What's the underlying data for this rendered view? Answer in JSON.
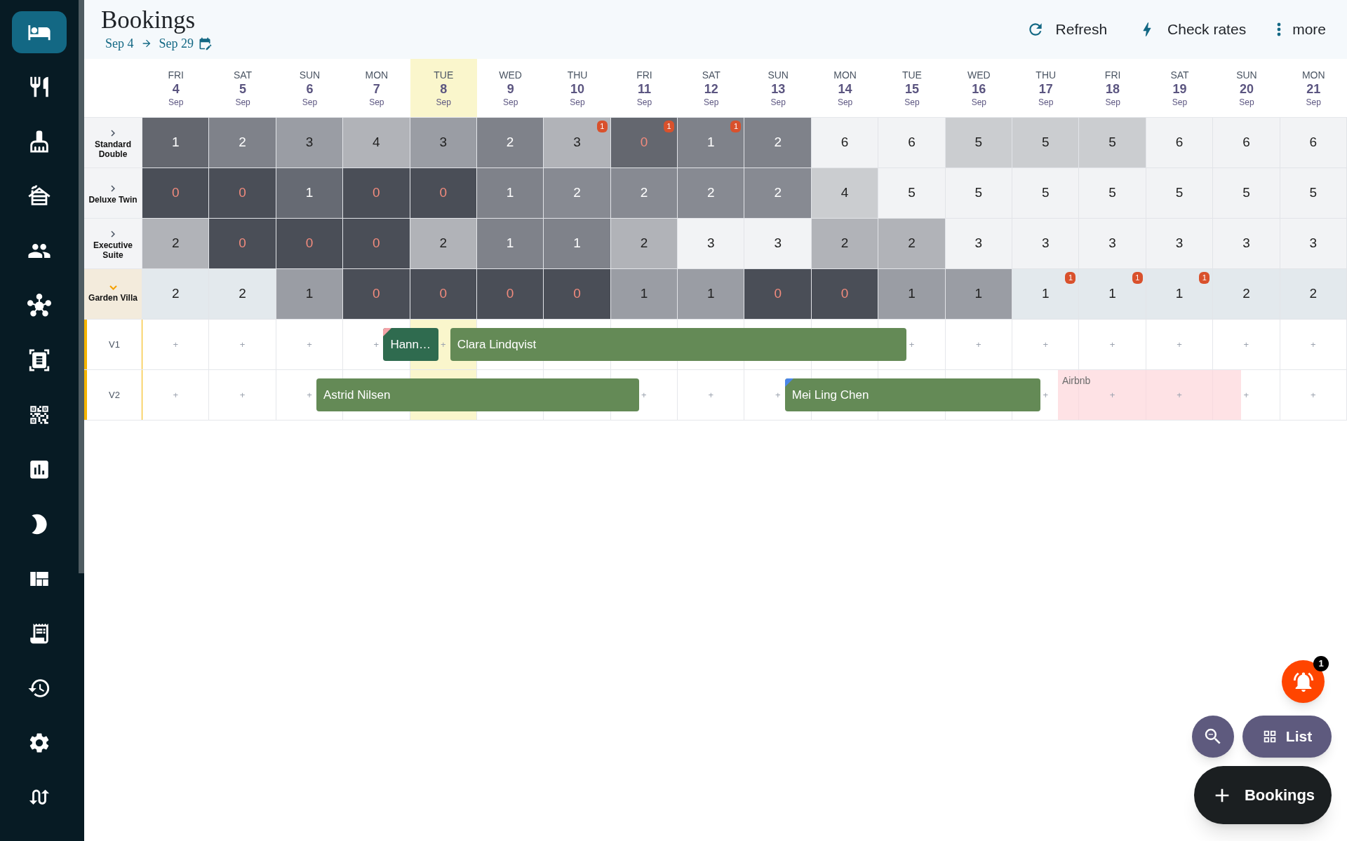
{
  "sidebar": {
    "items": [
      {
        "selected": true
      },
      {
        "selected": false
      },
      {
        "selected": false
      },
      {
        "selected": false
      },
      {
        "selected": false
      },
      {
        "selected": false
      },
      {
        "selected": false
      },
      {
        "selected": false
      },
      {
        "selected": false
      },
      {
        "selected": false
      },
      {
        "selected": false
      },
      {
        "selected": false
      },
      {
        "selected": false
      },
      {
        "selected": false
      },
      {
        "selected": false
      }
    ]
  },
  "header": {
    "title": "Bookings",
    "date_from": "Sep 4",
    "date_to": "Sep 29",
    "actions": [
      {
        "kind": "refresh",
        "label": "Refresh"
      },
      {
        "kind": "rates",
        "label": "Check rates"
      },
      {
        "kind": "more",
        "label": "more"
      }
    ]
  },
  "days": [
    {
      "weekday": "FRI",
      "day": "4",
      "month": "Sep",
      "today": false
    },
    {
      "weekday": "SAT",
      "day": "5",
      "month": "Sep",
      "today": false
    },
    {
      "weekday": "SUN",
      "day": "6",
      "month": "Sep",
      "today": false
    },
    {
      "weekday": "MON",
      "day": "7",
      "month": "Sep",
      "today": false
    },
    {
      "weekday": "TUE",
      "day": "8",
      "month": "Sep",
      "today": true
    },
    {
      "weekday": "WED",
      "day": "9",
      "month": "Sep",
      "today": false
    },
    {
      "weekday": "THU",
      "day": "10",
      "month": "Sep",
      "today": false
    },
    {
      "weekday": "FRI",
      "day": "11",
      "month": "Sep",
      "today": false
    },
    {
      "weekday": "SAT",
      "day": "12",
      "month": "Sep",
      "today": false
    },
    {
      "weekday": "SUN",
      "day": "13",
      "month": "Sep",
      "today": false
    },
    {
      "weekday": "MON",
      "day": "14",
      "month": "Sep",
      "today": false
    },
    {
      "weekday": "TUE",
      "day": "15",
      "month": "Sep",
      "today": false
    },
    {
      "weekday": "WED",
      "day": "16",
      "month": "Sep",
      "today": false
    },
    {
      "weekday": "THU",
      "day": "17",
      "month": "Sep",
      "today": false
    },
    {
      "weekday": "FRI",
      "day": "18",
      "month": "Sep",
      "today": false
    },
    {
      "weekday": "SAT",
      "day": "19",
      "month": "Sep",
      "today": false
    },
    {
      "weekday": "SUN",
      "day": "20",
      "month": "Sep",
      "today": false
    },
    {
      "weekday": "MON",
      "day": "21",
      "month": "Sep",
      "today": false
    }
  ],
  "rooms": [
    {
      "name": "Standard Double",
      "expanded": false,
      "cells": [
        {
          "value": "1",
          "color": "#64676f",
          "alert": false
        },
        {
          "value": "2",
          "color": "#7f828a",
          "alert": false
        },
        {
          "value": "3",
          "color": "#9a9da4",
          "alert": false
        },
        {
          "value": "4",
          "color": "#b1b3b8",
          "alert": false
        },
        {
          "value": "3",
          "color": "#9a9da4",
          "alert": false
        },
        {
          "value": "2",
          "color": "#7f828a",
          "alert": false
        },
        {
          "value": "3",
          "color": "#b1b3b8",
          "alert": false,
          "badge": "1"
        },
        {
          "value": "0",
          "color": "#64676f",
          "alert": true,
          "badge": "1"
        },
        {
          "value": "1",
          "color": "#7f828a",
          "alert": false,
          "badge": "1"
        },
        {
          "value": "2",
          "color": "#7f828a",
          "alert": false
        },
        {
          "value": "6",
          "color": "#f2f3f5",
          "alert": false
        },
        {
          "value": "6",
          "color": "#f2f3f5",
          "alert": false
        },
        {
          "value": "5",
          "color": "#cbcdd0",
          "alert": false
        },
        {
          "value": "5",
          "color": "#cbcdd0",
          "alert": false
        },
        {
          "value": "5",
          "color": "#cbcdd0",
          "alert": false
        },
        {
          "value": "6",
          "color": "#f2f3f5",
          "alert": false
        },
        {
          "value": "6",
          "color": "#f2f3f5",
          "alert": false
        },
        {
          "value": "6",
          "color": "#f2f3f5",
          "alert": false
        }
      ]
    },
    {
      "name": "Deluxe Twin",
      "expanded": false,
      "cells": [
        {
          "value": "0",
          "color": "#4a4e57",
          "alert": true
        },
        {
          "value": "0",
          "color": "#4a4e57",
          "alert": true
        },
        {
          "value": "1",
          "color": "#666a73",
          "alert": false
        },
        {
          "value": "0",
          "color": "#4a4e57",
          "alert": true
        },
        {
          "value": "0",
          "color": "#4a4e57",
          "alert": true
        },
        {
          "value": "1",
          "color": "#7f828a",
          "alert": false
        },
        {
          "value": "2",
          "color": "#878a92",
          "alert": false
        },
        {
          "value": "2",
          "color": "#878a92",
          "alert": false
        },
        {
          "value": "2",
          "color": "#878a92",
          "alert": false
        },
        {
          "value": "2",
          "color": "#878a92",
          "alert": false
        },
        {
          "value": "4",
          "color": "#cbcdd0",
          "alert": false
        },
        {
          "value": "5",
          "color": "#f2f3f5",
          "alert": false
        },
        {
          "value": "5",
          "color": "#f2f3f5",
          "alert": false
        },
        {
          "value": "5",
          "color": "#f2f3f5",
          "alert": false
        },
        {
          "value": "5",
          "color": "#f2f3f5",
          "alert": false
        },
        {
          "value": "5",
          "color": "#f2f3f5",
          "alert": false
        },
        {
          "value": "5",
          "color": "#f2f3f5",
          "alert": false
        },
        {
          "value": "5",
          "color": "#f2f3f5",
          "alert": false
        }
      ]
    },
    {
      "name": "Executive Suite",
      "expanded": false,
      "cells": [
        {
          "value": "2",
          "color": "#b1b3b8",
          "alert": false
        },
        {
          "value": "0",
          "color": "#4a4e57",
          "alert": true
        },
        {
          "value": "0",
          "color": "#4a4e57",
          "alert": true
        },
        {
          "value": "0",
          "color": "#4a4e57",
          "alert": true
        },
        {
          "value": "2",
          "color": "#b1b3b8",
          "alert": false
        },
        {
          "value": "1",
          "color": "#7f828a",
          "alert": false
        },
        {
          "value": "1",
          "color": "#7f828a",
          "alert": false
        },
        {
          "value": "2",
          "color": "#b1b3b8",
          "alert": false
        },
        {
          "value": "3",
          "color": "#f2f3f5",
          "alert": false
        },
        {
          "value": "3",
          "color": "#f2f3f5",
          "alert": false
        },
        {
          "value": "2",
          "color": "#b1b3b8",
          "alert": false
        },
        {
          "value": "2",
          "color": "#b1b3b8",
          "alert": false
        },
        {
          "value": "3",
          "color": "#f2f3f5",
          "alert": false
        },
        {
          "value": "3",
          "color": "#f2f3f5",
          "alert": false
        },
        {
          "value": "3",
          "color": "#f2f3f5",
          "alert": false
        },
        {
          "value": "3",
          "color": "#f2f3f5",
          "alert": false
        },
        {
          "value": "3",
          "color": "#f2f3f5",
          "alert": false
        },
        {
          "value": "3",
          "color": "#f2f3f5",
          "alert": false
        }
      ]
    },
    {
      "name": "Garden Villa",
      "expanded": true,
      "cells": [
        {
          "value": "2",
          "color": "#e3e9ed",
          "alert": false
        },
        {
          "value": "2",
          "color": "#e3e9ed",
          "alert": false
        },
        {
          "value": "1",
          "color": "#9a9da4",
          "alert": false
        },
        {
          "value": "0",
          "color": "#4a4e57",
          "alert": true
        },
        {
          "value": "0",
          "color": "#4a4e57",
          "alert": true
        },
        {
          "value": "0",
          "color": "#4a4e57",
          "alert": true
        },
        {
          "value": "0",
          "color": "#4a4e57",
          "alert": true
        },
        {
          "value": "1",
          "color": "#9a9da4",
          "alert": false
        },
        {
          "value": "1",
          "color": "#9a9da4",
          "alert": false
        },
        {
          "value": "0",
          "color": "#4a4e57",
          "alert": true
        },
        {
          "value": "0",
          "color": "#4a4e57",
          "alert": true
        },
        {
          "value": "1",
          "color": "#9a9da4",
          "alert": false
        },
        {
          "value": "1",
          "color": "#9a9da4",
          "alert": false
        },
        {
          "value": "1",
          "color": "#e3e9ed",
          "alert": false,
          "badge": "1"
        },
        {
          "value": "1",
          "color": "#e3e9ed",
          "alert": false,
          "badge": "1"
        },
        {
          "value": "1",
          "color": "#e3e9ed",
          "alert": false,
          "badge": "1"
        },
        {
          "value": "2",
          "color": "#e3e9ed",
          "alert": false
        },
        {
          "value": "2",
          "color": "#e3e9ed",
          "alert": false
        }
      ]
    }
  ],
  "units": [
    {
      "name": "V1",
      "cells": [
        {
          "kind": "free",
          "label": "+"
        },
        {
          "kind": "free",
          "label": "+"
        },
        {
          "kind": "free",
          "label": "+"
        },
        {
          "kind": "free",
          "label": "+",
          "booking": {
            "kind": "guest",
            "guest": "Hann…",
            "color": "#2f6b4f",
            "flag": {
              "color": "#f4a3a8"
            }
          }
        },
        {
          "kind": "free",
          "label": "+",
          "booking": {
            "kind": "guest",
            "guest": "Clara Lindqvist",
            "color": "#648a56"
          }
        },
        {
          "kind": "occupied"
        },
        {
          "kind": "occupied"
        },
        {
          "kind": "occupied"
        },
        {
          "kind": "occupied"
        },
        {
          "kind": "occupied"
        },
        {
          "kind": "occupied"
        },
        {
          "kind": "free",
          "label": "+"
        },
        {
          "kind": "free",
          "label": "+"
        },
        {
          "kind": "free",
          "label": "+"
        },
        {
          "kind": "free",
          "label": "+"
        },
        {
          "kind": "free",
          "label": "+"
        },
        {
          "kind": "free",
          "label": "+"
        },
        {
          "kind": "free",
          "label": "+"
        }
      ]
    },
    {
      "name": "V2",
      "cells": [
        {
          "kind": "free",
          "label": "+"
        },
        {
          "kind": "free",
          "label": "+"
        },
        {
          "kind": "free",
          "label": "+",
          "booking": {
            "kind": "guest",
            "guest": "Astrid Nilsen",
            "color": "#648a56"
          }
        },
        {
          "kind": "occupied"
        },
        {
          "kind": "occupied"
        },
        {
          "kind": "occupied"
        },
        {
          "kind": "occupied"
        },
        {
          "kind": "free",
          "label": "+"
        },
        {
          "kind": "free",
          "label": "+"
        },
        {
          "kind": "free",
          "label": "+",
          "booking": {
            "kind": "guest",
            "guest": "Mei Ling Chen",
            "color": "#648a56",
            "flag": {
              "color": "#4a86e8"
            }
          }
        },
        {
          "kind": "occupied"
        },
        {
          "kind": "occupied"
        },
        {
          "kind": "occupied"
        },
        {
          "kind": "free",
          "label": "+",
          "booking": {
            "kind": "block",
            "guest": "Airbnb"
          }
        },
        {
          "kind": "blocked",
          "label": "+"
        },
        {
          "kind": "blocked",
          "label": "+"
        },
        {
          "kind": "free",
          "label": "+"
        },
        {
          "kind": "free",
          "label": "+"
        }
      ]
    }
  ],
  "floating": {
    "notification_count": "1",
    "list_label": "List",
    "add_label": "Bookings"
  }
}
